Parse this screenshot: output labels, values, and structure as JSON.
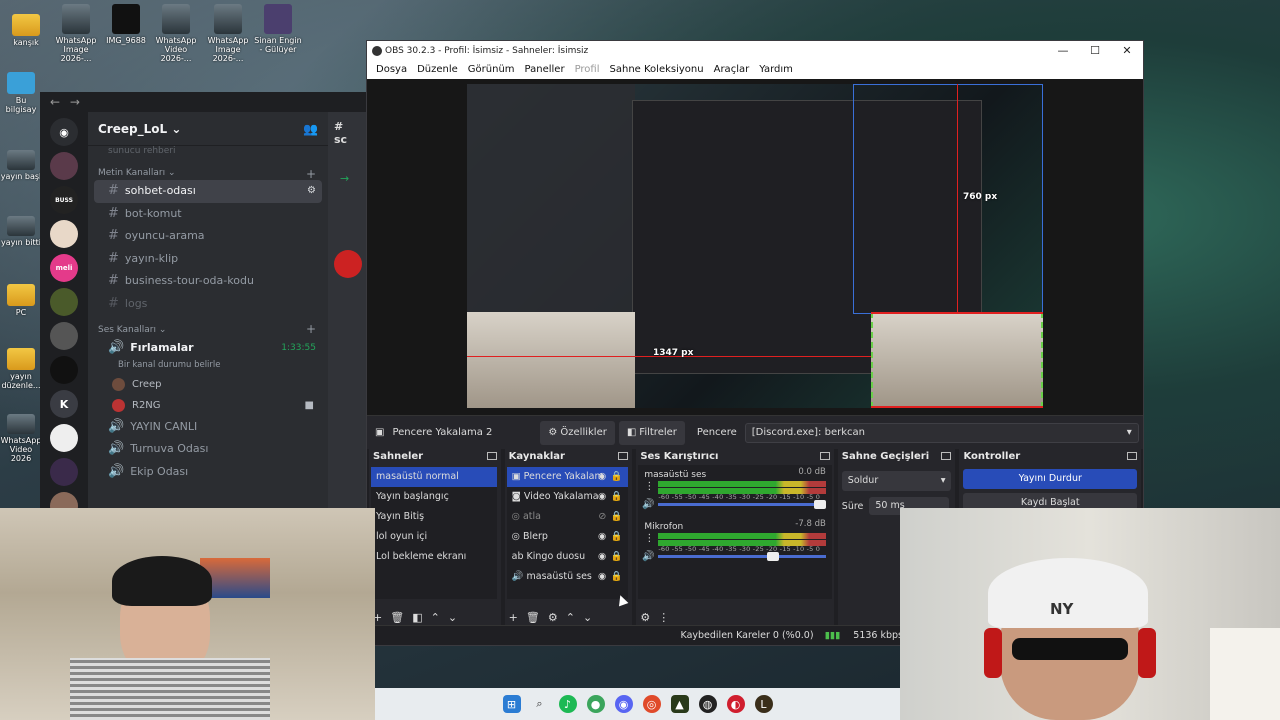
{
  "desktop": {
    "icons_top": [
      {
        "label": "kanşık"
      },
      {
        "label": "WhatsApp Image 2026-..."
      },
      {
        "label": "IMG_9688"
      },
      {
        "label": "WhatsApp Video 2026-..."
      },
      {
        "label": "WhatsApp Image 2026-..."
      },
      {
        "label": "Sinan Engin - Gülüyer"
      }
    ],
    "icons_left": [
      {
        "label": "Bu bilgisay"
      },
      {
        "label": "yayın başl"
      },
      {
        "label": "yayın bitti"
      },
      {
        "label": "PC"
      },
      {
        "label": "yayın düzenle..."
      },
      {
        "label": "WhatsApp Video 2026"
      }
    ]
  },
  "discord": {
    "server_name": "Creep_LoL",
    "partial_top": "sunucu rehberi",
    "text_category": "Metin Kanalları",
    "text_channels": [
      {
        "name": "sohbet-odası",
        "active": true
      },
      {
        "name": "bot-komut",
        "active": false
      },
      {
        "name": "oyuncu-arama",
        "active": false
      },
      {
        "name": "yayın-klip",
        "active": false
      },
      {
        "name": "business-tour-oda-kodu",
        "active": false
      },
      {
        "name": "logs",
        "active": false
      }
    ],
    "voice_category": "Ses Kanalları",
    "voice_active": {
      "name": "Fırlamalar",
      "time": "1:33:55",
      "status": "Bir kanal durumu belirle"
    },
    "voice_users": [
      "Creep",
      "R2NG"
    ],
    "voice_channels": [
      "YAYIN CANLI",
      "Turnuva Odası",
      "Ekip Odası"
    ],
    "right_partial": "sc"
  },
  "obs": {
    "title": "OBS 30.2.3 - Profil: İsimsiz - Sahneler: İsimsiz",
    "menu": [
      {
        "label": "Dosya",
        "disabled": false
      },
      {
        "label": "Düzenle",
        "disabled": false
      },
      {
        "label": "Görünüm",
        "disabled": false
      },
      {
        "label": "Paneller",
        "disabled": false
      },
      {
        "label": "Profil",
        "disabled": true
      },
      {
        "label": "Sahne Koleksiyonu",
        "disabled": false
      },
      {
        "label": "Araçlar",
        "disabled": false
      },
      {
        "label": "Yardım",
        "disabled": false
      }
    ],
    "preview": {
      "label_width": "1347 px",
      "label_height": "760 px"
    },
    "source_bar": {
      "source_name": "Pencere Yakalama 2",
      "properties": "Özellikler",
      "filters": "Filtreler",
      "window_label": "Pencere",
      "window_value": "[Discord.exe]: berkcan"
    },
    "scenes": {
      "title": "Sahneler",
      "items": [
        "masaüstü normal",
        "Yayın başlangıç",
        "Yayın Bitiş",
        "lol oyun içi",
        "Lol bekleme ekranı"
      ],
      "selected": 0
    },
    "sources": {
      "title": "Kaynaklar",
      "items": [
        {
          "name": "Pencere Yakalam",
          "icon": "window-icon",
          "visible": true,
          "selected": true
        },
        {
          "name": "Video Yakalama",
          "icon": "camera-icon",
          "visible": true,
          "selected": false
        },
        {
          "name": "atla",
          "icon": "browser-icon",
          "visible": false,
          "selected": false
        },
        {
          "name": "Blerp",
          "icon": "browser-icon",
          "visible": true,
          "selected": false
        },
        {
          "name": "Kingo duosu",
          "icon": "text-icon",
          "visible": true,
          "selected": false
        },
        {
          "name": "masaüstü ses",
          "icon": "speaker-icon",
          "visible": true,
          "selected": false
        }
      ]
    },
    "mixer": {
      "title": "Ses Karıştırıcı",
      "scale": "-60 -55 -50 -45 -40 -35 -30 -25 -20 -15 -10 -5 0",
      "channels": [
        {
          "name": "masaüstü ses",
          "db": "0.0 dB",
          "volume": 1.0
        },
        {
          "name": "Mikrofon",
          "db": "-7.8 dB",
          "volume": 0.72
        }
      ]
    },
    "transitions": {
      "title": "Sahne Geçişleri",
      "selected": "Soldur",
      "duration_label": "Süre",
      "duration": "50 ms"
    },
    "controls": {
      "title": "Kontroller",
      "stop_stream": "Yayını Durdur",
      "start_record": "Kaydı Başlat"
    },
    "status": {
      "dropped": "Kaybedilen Kareler 0 (%0.0)",
      "bitrate": "5136 kbps"
    }
  },
  "colors": {
    "accent": "#284cb8",
    "discord_bg": "#2b2d31",
    "obs_bg": "#1f1f23",
    "selection_red": "#e02020"
  }
}
